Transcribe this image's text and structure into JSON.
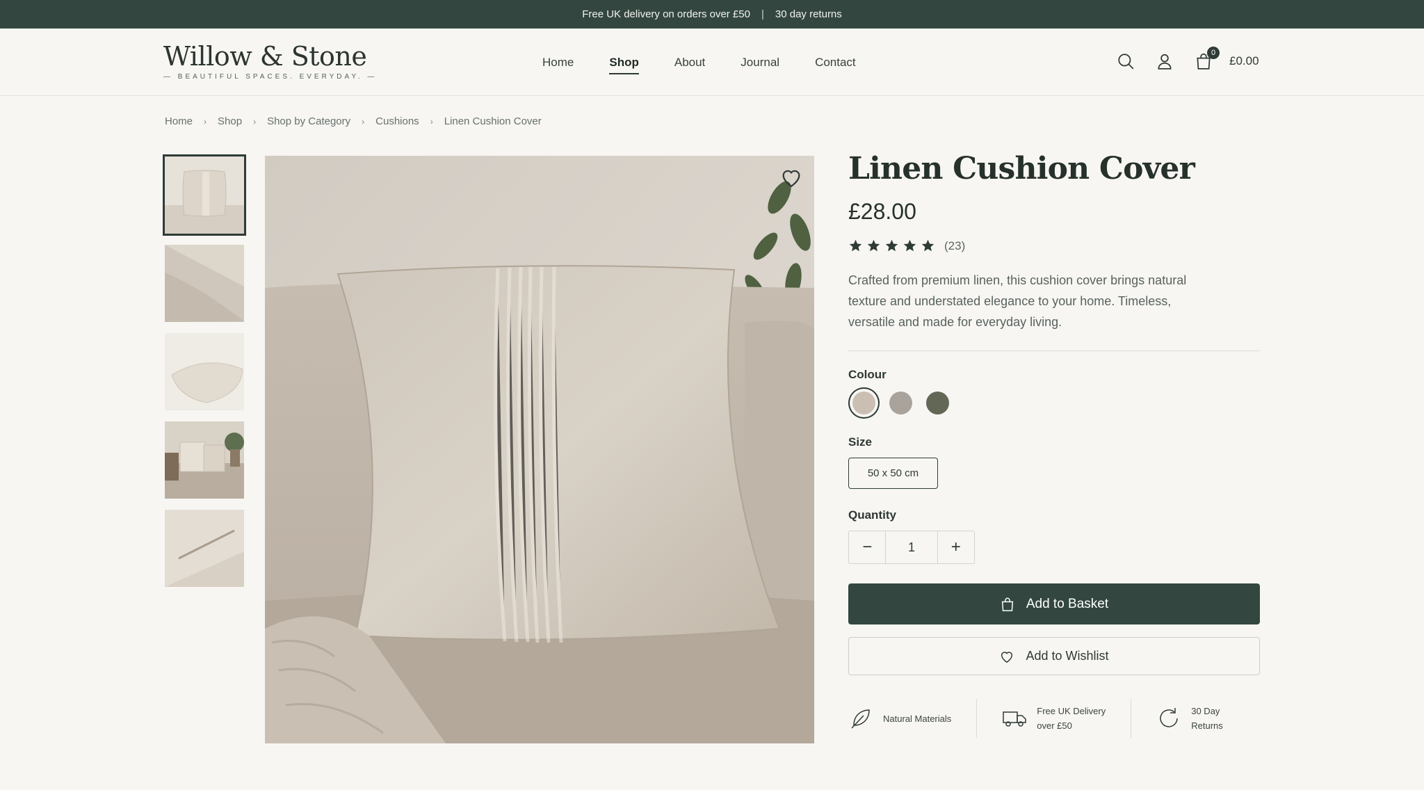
{
  "announcement": {
    "delivery": "Free UK delivery on orders over £50",
    "separator": "|",
    "returns": "30 day returns"
  },
  "brand": {
    "name": "Willow & Stone",
    "tagline": "— BEAUTIFUL SPACES. EVERYDAY. —"
  },
  "nav": {
    "items": [
      {
        "label": "Home"
      },
      {
        "label": "Shop",
        "active": true
      },
      {
        "label": "About"
      },
      {
        "label": "Journal"
      },
      {
        "label": "Contact"
      }
    ]
  },
  "header_icons": [
    "search-icon",
    "account-icon",
    "bag-icon"
  ],
  "cart": {
    "count": "0",
    "total": "£0.00"
  },
  "breadcrumb": [
    "Home",
    "Shop",
    "Shop by Category",
    "Cushions",
    "Linen Cushion Cover"
  ],
  "gallery": {
    "thumbnails": [
      "cushion-front",
      "fabric-closeup",
      "cushion-angled",
      "sofa-styled",
      "zip-detail"
    ],
    "selected_index": 0
  },
  "product": {
    "title": "Linen Cushion Cover",
    "price": "£28.00",
    "rating": 5,
    "review_count": "(23)",
    "description": "Crafted from premium linen, this cushion cover brings natural texture and understated elegance to your home. Timeless, versatile and made for everyday living."
  },
  "options": {
    "colour_label": "Colour",
    "colours": [
      "#cbbfb3",
      "#a9a39c",
      "#626756"
    ],
    "selected_colour": 0,
    "size_label": "Size",
    "size_value": "50 x 50 cm",
    "quantity_label": "Quantity",
    "quantity": "1",
    "minus": "−",
    "plus": "+"
  },
  "actions": {
    "add_to_basket": "Add to Basket",
    "add_to_wishlist": "Add to Wishlist"
  },
  "features": [
    {
      "icon": "leaf-icon",
      "line1": "Natural Materials",
      "line2": ""
    },
    {
      "icon": "truck-icon",
      "line1": "Free UK Delivery",
      "line2": "over £50"
    },
    {
      "icon": "returns-icon",
      "line1": "30 Day",
      "line2": "Returns"
    }
  ],
  "colors": {
    "primary": "#334740",
    "background": "#f7f6f3"
  }
}
